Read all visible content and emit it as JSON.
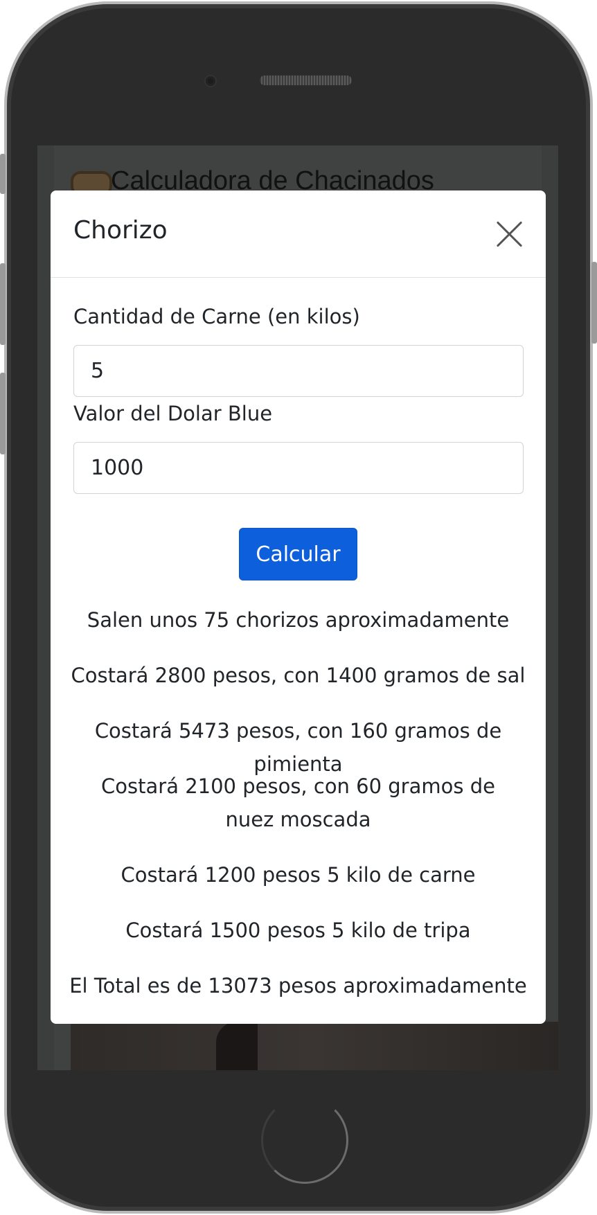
{
  "background": {
    "title": "Calculadora de Chacinados"
  },
  "modal": {
    "title": "Chorizo",
    "fields": [
      {
        "label": "Cantidad de Carne (en kilos)",
        "value": "5"
      },
      {
        "label": "Valor del Dolar Blue",
        "value": "1000"
      }
    ],
    "button_label": "Calcular",
    "results": [
      "Salen unos 75 chorizos aproximadamente",
      "Costará 2800 pesos, con 1400 gramos de sal",
      "Costará 5473 pesos, con 160 gramos de pimienta",
      "Costará 2100 pesos, con 60 gramos de nuez moscada",
      "Costará 1200 pesos 5 kilo de carne",
      "Costará 1500 pesos 5 kilo de tripa",
      "El Total es de 13073 pesos aproximadamente"
    ]
  },
  "colors": {
    "primary_button": "#0d5fdb",
    "overlay": "#404241"
  },
  "icons": {
    "close": "close-icon",
    "title_emoji": "bread-icon"
  }
}
